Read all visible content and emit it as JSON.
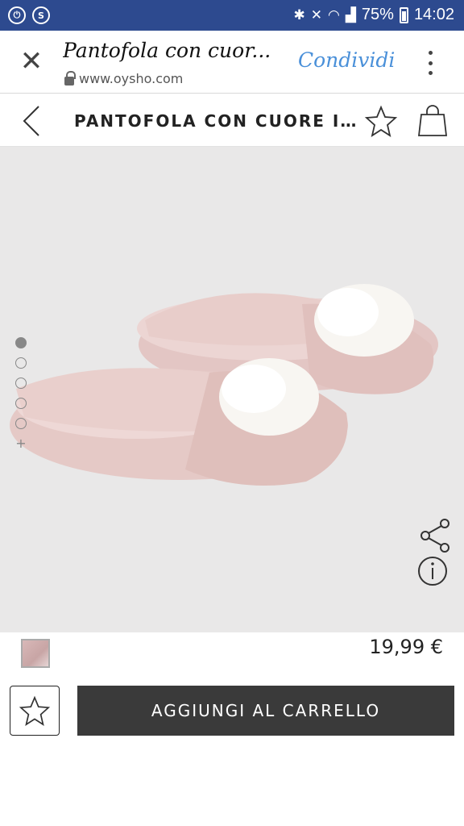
{
  "status_bar": {
    "left_icons": [
      "power-circle-icon",
      "shazam-icon"
    ],
    "right_icons": [
      "bluetooth-icon",
      "mute-icon",
      "wifi-icon",
      "signal-icon",
      "battery-icon"
    ],
    "battery": "75%",
    "time": "14:02"
  },
  "tab_header": {
    "title": "Pantofola con cuor...",
    "url": "www.oysho.com",
    "share_label": "Condividi"
  },
  "product_header": {
    "title": "PANTOFOLA CON CUORE I..."
  },
  "gallery": {
    "image_count": 5,
    "active_index": 0,
    "more_label": "+"
  },
  "product": {
    "price": "19,99 €",
    "swatch_color": "#d4b3b3",
    "add_to_cart_label": "AGGIUNGI AL CARRELLO"
  },
  "colors": {
    "status_bar": "#2d4a8f",
    "share_link": "#4a90d9",
    "cart_button": "#3a3a3a",
    "gallery_bg": "#e9e8e8"
  }
}
